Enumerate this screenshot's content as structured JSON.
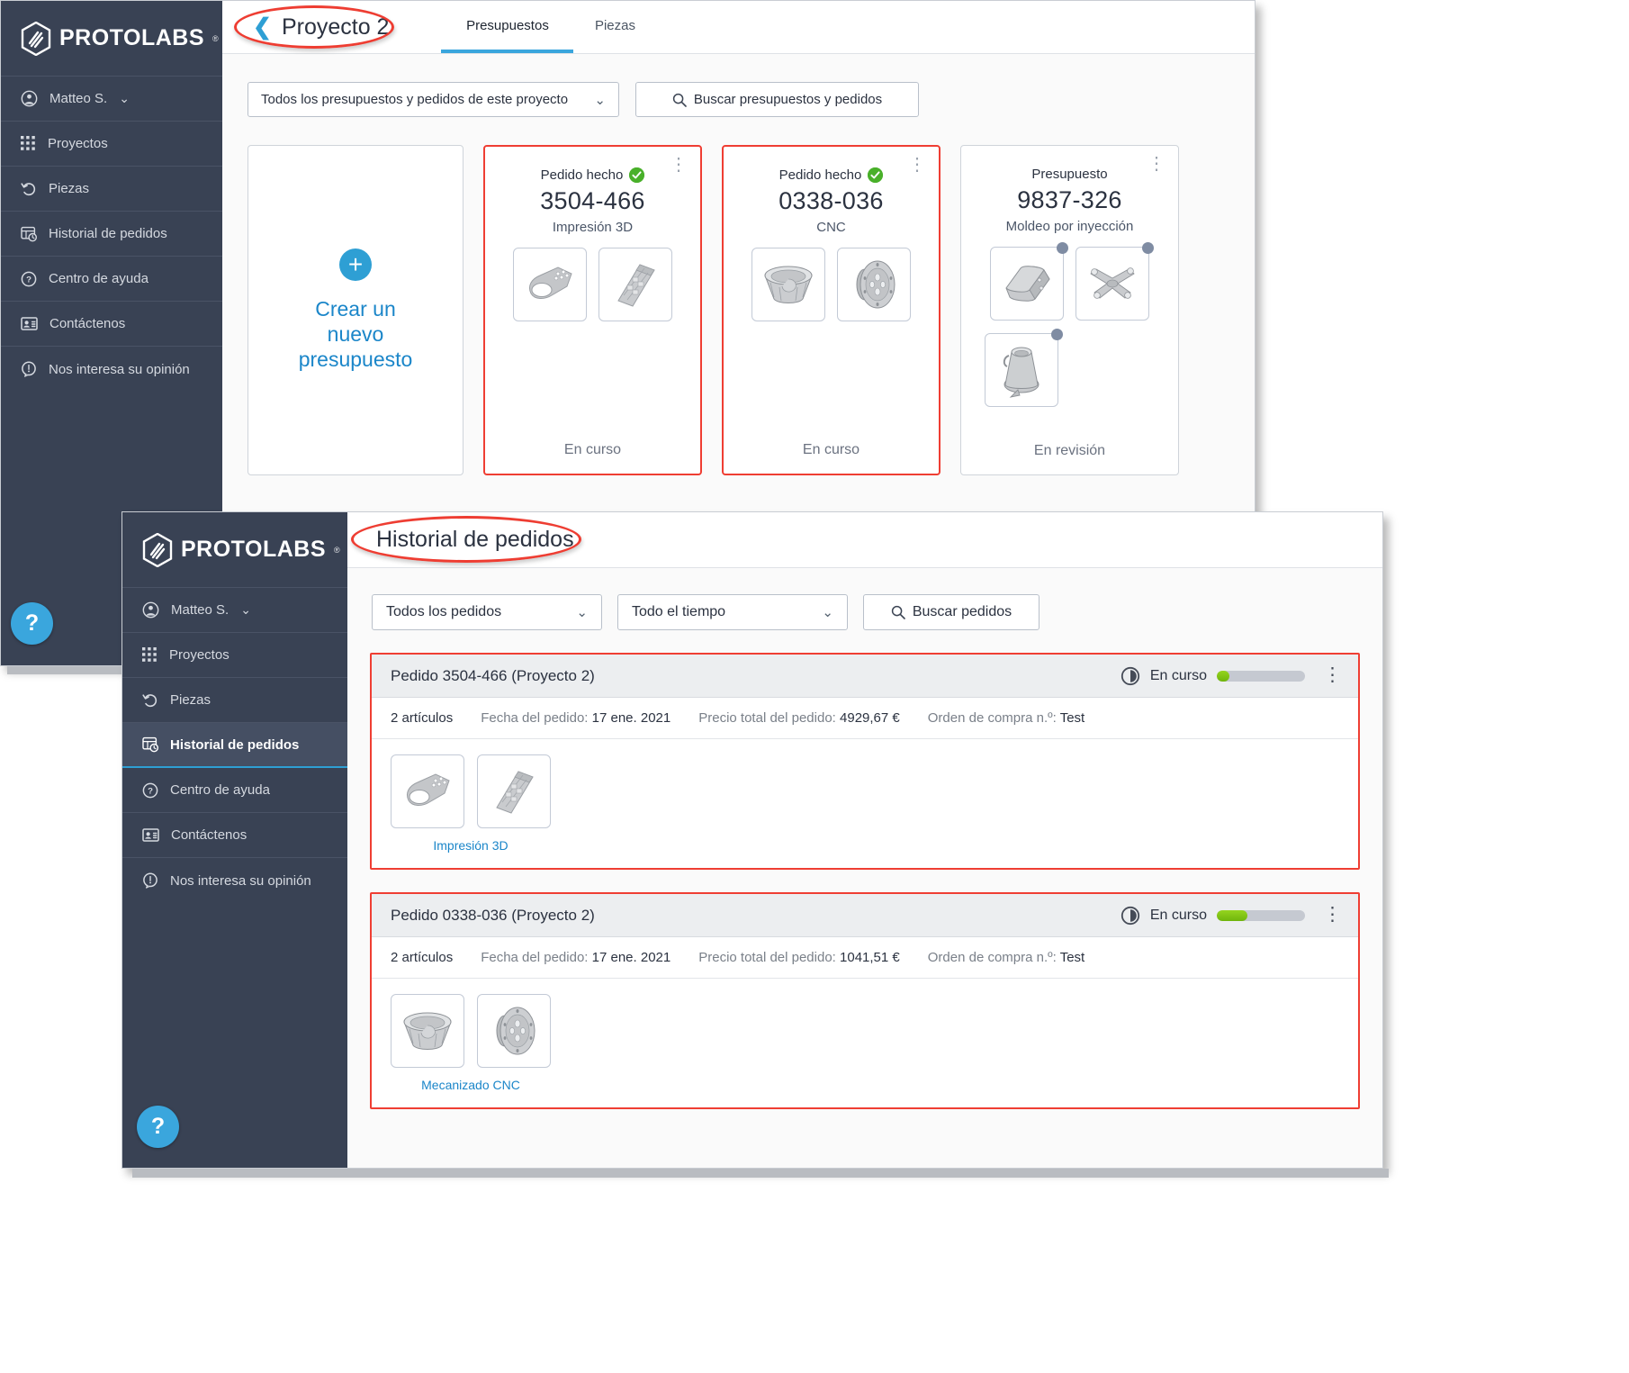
{
  "brand": {
    "name": "PROTOLABS",
    "registered": "®"
  },
  "window1": {
    "sidebar": {
      "user": {
        "label": "Matteo S.",
        "caret": "⌄",
        "icon": "user-circle-icon"
      },
      "items": [
        {
          "label": "Proyectos",
          "icon": "grid-icon"
        },
        {
          "label": "Piezas",
          "icon": "history-arrow-icon"
        },
        {
          "label": "Historial de pedidos",
          "icon": "order-history-icon"
        },
        {
          "label": "Centro de ayuda",
          "icon": "question-circle-icon"
        },
        {
          "label": "Contáctenos",
          "icon": "contact-card-icon"
        },
        {
          "label": "Nos interesa su opinión",
          "icon": "feedback-bubble-icon"
        }
      ],
      "help_fab": "?"
    },
    "header": {
      "back_chevron": "❮",
      "title": "Proyecto 2",
      "tabs": [
        {
          "label": "Presupuestos",
          "active": true
        },
        {
          "label": "Piezas",
          "active": false
        }
      ]
    },
    "filters": {
      "scope_select": "Todos los presupuestos y pedidos de este proyecto",
      "scope_caret": "⌄",
      "search_label": "Buscar presupuestos y pedidos",
      "search_icon": "search-icon"
    },
    "new_quote": {
      "plus": "+",
      "line1": "Crear un",
      "line2": "nuevo",
      "line3": "presupuesto"
    },
    "cards": [
      {
        "status_top": "Pedido hecho",
        "has_check": true,
        "number": "3504-466",
        "process": "Impresión 3D",
        "footer": "En curso",
        "highlighted": true,
        "parts": [
          {
            "shape": "bracket-part",
            "dot": false
          },
          {
            "shape": "connector-part",
            "dot": false
          }
        ]
      },
      {
        "status_top": "Pedido hecho",
        "has_check": true,
        "number": "0338-036",
        "process": "CNC",
        "footer": "En curso",
        "highlighted": true,
        "parts": [
          {
            "shape": "bowl-part",
            "dot": false
          },
          {
            "shape": "disc-part",
            "dot": false
          }
        ]
      },
      {
        "status_top": "Presupuesto",
        "has_check": false,
        "number": "9837-326",
        "process": "Moldeo por inyección",
        "footer": "En revisión",
        "highlighted": false,
        "parts": [
          {
            "shape": "block-part",
            "dot": true
          },
          {
            "shape": "cross-part",
            "dot": true
          },
          {
            "shape": "cone-part",
            "dot": true
          }
        ]
      }
    ]
  },
  "window2": {
    "sidebar": {
      "user": {
        "label": "Matteo S.",
        "caret": "⌄",
        "icon": "user-circle-icon"
      },
      "items": [
        {
          "label": "Proyectos",
          "icon": "grid-icon",
          "active": false
        },
        {
          "label": "Piezas",
          "icon": "history-arrow-icon",
          "active": false
        },
        {
          "label": "Historial de pedidos",
          "icon": "order-history-icon",
          "active": true
        },
        {
          "label": "Centro de ayuda",
          "icon": "question-circle-icon",
          "active": false
        },
        {
          "label": "Contáctenos",
          "icon": "contact-card-icon",
          "active": false
        },
        {
          "label": "Nos interesa su opinión",
          "icon": "feedback-bubble-icon",
          "active": false
        }
      ],
      "help_fab": "?"
    },
    "header": {
      "title": "Historial de pedidos"
    },
    "filters": {
      "orders_select": "Todos los pedidos",
      "orders_caret": "⌄",
      "time_select": "Todo el tiempo",
      "time_caret": "⌄",
      "search_label": "Buscar pedidos",
      "search_icon": "search-icon"
    },
    "orders": [
      {
        "title": "Pedido 3504-466 (Proyecto 2)",
        "status_icon": "clock-half-icon",
        "status": "En curso",
        "progress_pct": 14,
        "kebab": "⋮",
        "meta": {
          "items": "2 artículos",
          "date_label": "Fecha del pedido:",
          "date_value": "17 ene. 2021",
          "price_label": "Precio total del pedido:",
          "price_value": "4929,67 €",
          "po_label": "Orden de compra n.º:",
          "po_value": "Test"
        },
        "process_label": "Impresión 3D",
        "parts": [
          {
            "shape": "bracket-part"
          },
          {
            "shape": "connector-part"
          }
        ]
      },
      {
        "title": "Pedido 0338-036 (Proyecto 2)",
        "status_icon": "clock-half-icon",
        "status": "En curso",
        "progress_pct": 35,
        "kebab": "⋮",
        "meta": {
          "items": "2 artículos",
          "date_label": "Fecha del pedido:",
          "date_value": "17 ene. 2021",
          "price_label": "Precio total del pedido:",
          "price_value": "1041,51 €",
          "po_label": "Orden de compra n.º:",
          "po_value": "Test"
        },
        "process_label": "Mecanizado CNC",
        "parts": [
          {
            "shape": "bowl-part"
          },
          {
            "shape": "disc-part"
          }
        ]
      }
    ]
  },
  "annotations": {
    "accent_red": "#ee3d32",
    "accent_blue": "#3aa6dd",
    "green": "#49b02a"
  }
}
